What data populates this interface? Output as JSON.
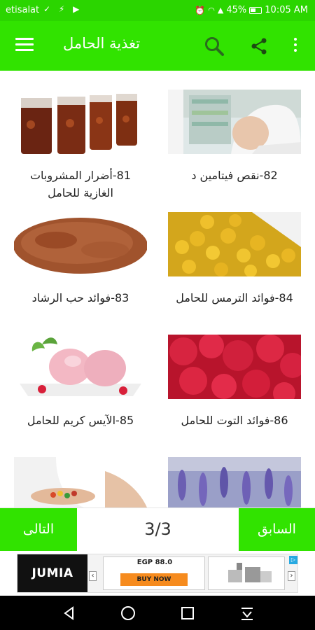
{
  "status_bar": {
    "carrier": "etisalat",
    "battery": "45%",
    "time": "10:05 AM"
  },
  "app_bar": {
    "title": "تغذية الحامل"
  },
  "items": [
    {
      "caption": "82-نقص فيتامين د",
      "image": "pregnant-woman-pharmacy"
    },
    {
      "caption": "81-أضرار المشروبات الغازية للحامل",
      "image": "soda-glasses"
    },
    {
      "caption": "84-فوائد الترمس للحامل",
      "image": "lupin-beans"
    },
    {
      "caption": "83-فوائد حب الرشاد",
      "image": "cress-seed-powder"
    },
    {
      "caption": "86-فوائد التوت للحامل",
      "image": "raspberries"
    },
    {
      "caption": "85-الآيس كريم للحامل",
      "image": "strawberry-ice-cream"
    },
    {
      "caption": "",
      "image": "lavender-flowers"
    },
    {
      "caption": "",
      "image": "pregnant-belly-pills"
    }
  ],
  "pager": {
    "next_label": "التالى",
    "page_count": "3/3",
    "prev_label": "السابق"
  },
  "ad": {
    "brand": "JUMIA",
    "price": "EGP 88.0",
    "buy_label": "BUY NOW"
  },
  "colors": {
    "status_bar": "#2bd500",
    "app_bar": "#31e300",
    "pager_button": "#31e300",
    "ad_buy": "#f68b1e"
  }
}
